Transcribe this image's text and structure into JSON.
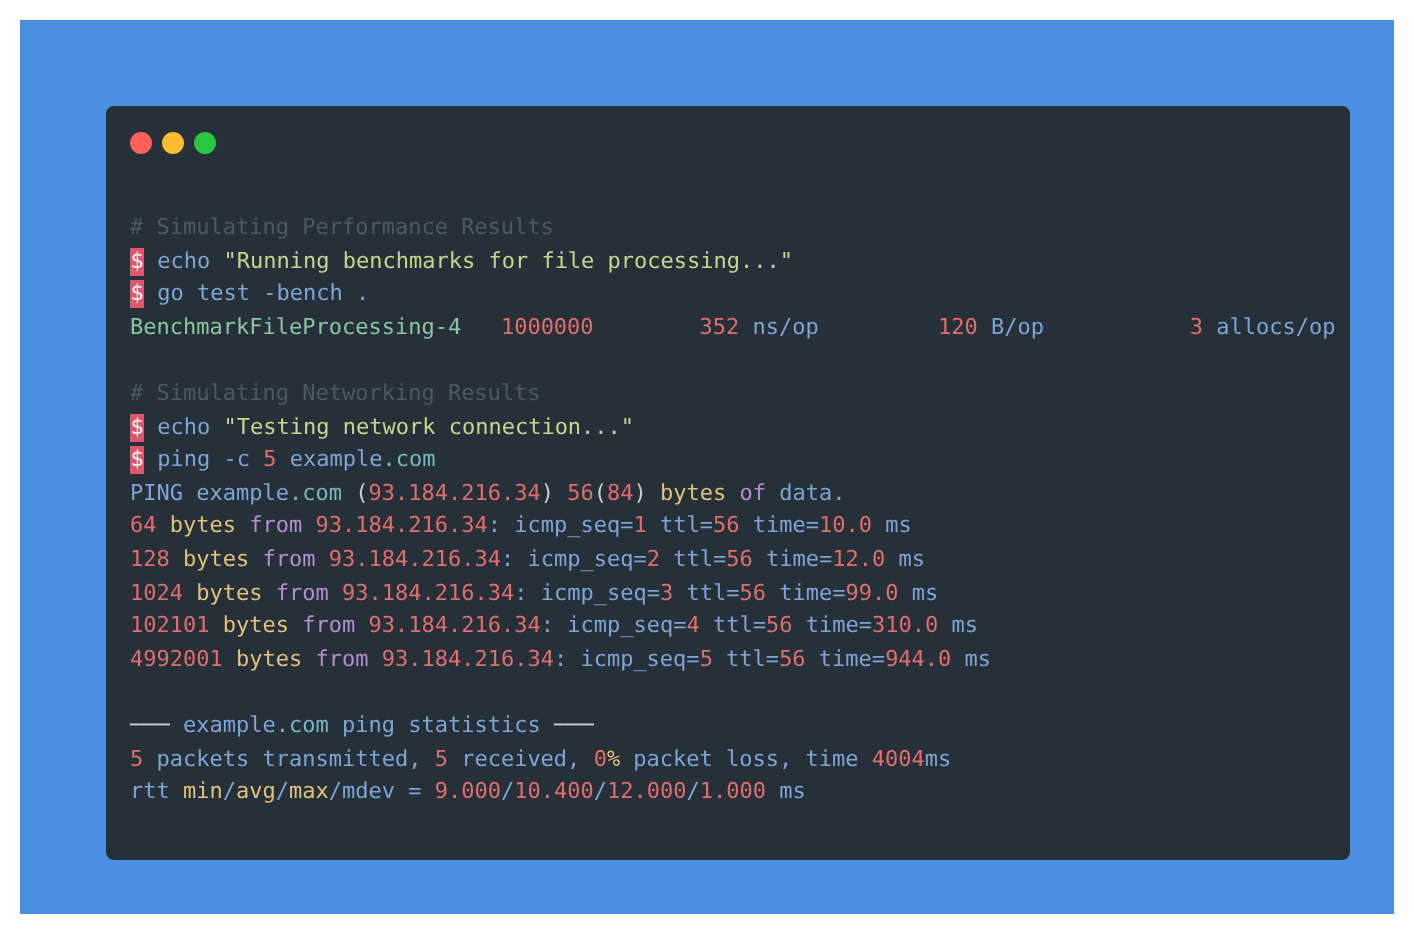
{
  "window": {
    "controls": [
      {
        "kind": "close"
      },
      {
        "kind": "minimize"
      },
      {
        "kind": "maximize"
      }
    ]
  },
  "blocks": [
    {
      "lines": [
        [
          {
            "kind": "comment",
            "text": "# Simulating Performance Results"
          }
        ],
        [
          {
            "kind": "prompt",
            "text": "$"
          },
          {
            "kind": "command",
            "text": " echo "
          },
          {
            "kind": "string",
            "text": "\"Running benchmarks for file processing...\""
          }
        ],
        [
          {
            "kind": "prompt",
            "text": "$"
          },
          {
            "kind": "command",
            "text": " go test -bench ."
          }
        ],
        [
          {
            "kind": "name",
            "text": "BenchmarkFileProcessing-4"
          },
          {
            "kind": "number",
            "text": "   1000000"
          },
          {
            "kind": "number",
            "text": "        352"
          },
          {
            "kind": "command",
            "text": " ns/op"
          },
          {
            "kind": "number",
            "text": "         120"
          },
          {
            "kind": "command",
            "text": " B/op"
          },
          {
            "kind": "number",
            "text": "           3"
          },
          {
            "kind": "command",
            "text": " allocs/op"
          }
        ]
      ]
    },
    {
      "lines": [
        [
          {
            "kind": "comment",
            "text": "# Simulating Networking Results"
          }
        ],
        [
          {
            "kind": "prompt",
            "text": "$"
          },
          {
            "kind": "command",
            "text": " echo "
          },
          {
            "kind": "string",
            "text": "\"Testing network connection...\""
          }
        ],
        [
          {
            "kind": "prompt",
            "text": "$"
          },
          {
            "kind": "command",
            "text": " ping -c "
          },
          {
            "kind": "number",
            "text": "5"
          },
          {
            "kind": "command",
            "text": " example"
          },
          {
            "kind": "domain",
            "text": ".com"
          }
        ],
        [
          {
            "kind": "command",
            "text": "PING example"
          },
          {
            "kind": "domain",
            "text": ".com"
          },
          {
            "kind": "plain",
            "text": " ("
          },
          {
            "kind": "number",
            "text": "93.184.216.34"
          },
          {
            "kind": "plain",
            "text": ") "
          },
          {
            "kind": "number",
            "text": "56"
          },
          {
            "kind": "plain",
            "text": "("
          },
          {
            "kind": "number",
            "text": "84"
          },
          {
            "kind": "plain",
            "text": ") "
          },
          {
            "kind": "unit",
            "text": "bytes"
          },
          {
            "kind": "keyword",
            "text": " of "
          },
          {
            "kind": "command",
            "text": "data."
          }
        ],
        [
          {
            "kind": "number",
            "text": "64"
          },
          {
            "kind": "unit",
            "text": " bytes"
          },
          {
            "kind": "keyword",
            "text": " from "
          },
          {
            "kind": "number",
            "text": "93.184.216.34"
          },
          {
            "kind": "command",
            "text": ": icmp_seq="
          },
          {
            "kind": "number",
            "text": "1"
          },
          {
            "kind": "command",
            "text": " ttl="
          },
          {
            "kind": "number",
            "text": "56"
          },
          {
            "kind": "command",
            "text": " time="
          },
          {
            "kind": "number",
            "text": "10.0"
          },
          {
            "kind": "command",
            "text": " ms"
          }
        ],
        [
          {
            "kind": "number",
            "text": "128"
          },
          {
            "kind": "unit",
            "text": " bytes"
          },
          {
            "kind": "keyword",
            "text": " from "
          },
          {
            "kind": "number",
            "text": "93.184.216.34"
          },
          {
            "kind": "command",
            "text": ": icmp_seq="
          },
          {
            "kind": "number",
            "text": "2"
          },
          {
            "kind": "command",
            "text": " ttl="
          },
          {
            "kind": "number",
            "text": "56"
          },
          {
            "kind": "command",
            "text": " time="
          },
          {
            "kind": "number",
            "text": "12.0"
          },
          {
            "kind": "command",
            "text": " ms"
          }
        ],
        [
          {
            "kind": "number",
            "text": "1024"
          },
          {
            "kind": "unit",
            "text": " bytes"
          },
          {
            "kind": "keyword",
            "text": " from "
          },
          {
            "kind": "number",
            "text": "93.184.216.34"
          },
          {
            "kind": "command",
            "text": ": icmp_seq="
          },
          {
            "kind": "number",
            "text": "3"
          },
          {
            "kind": "command",
            "text": " ttl="
          },
          {
            "kind": "number",
            "text": "56"
          },
          {
            "kind": "command",
            "text": " time="
          },
          {
            "kind": "number",
            "text": "99.0"
          },
          {
            "kind": "command",
            "text": " ms"
          }
        ],
        [
          {
            "kind": "number",
            "text": "102101"
          },
          {
            "kind": "unit",
            "text": " bytes"
          },
          {
            "kind": "keyword",
            "text": " from "
          },
          {
            "kind": "number",
            "text": "93.184.216.34"
          },
          {
            "kind": "command",
            "text": ": icmp_seq="
          },
          {
            "kind": "number",
            "text": "4"
          },
          {
            "kind": "command",
            "text": " ttl="
          },
          {
            "kind": "number",
            "text": "56"
          },
          {
            "kind": "command",
            "text": " time="
          },
          {
            "kind": "number",
            "text": "310.0"
          },
          {
            "kind": "command",
            "text": " ms"
          }
        ],
        [
          {
            "kind": "number",
            "text": "4992001"
          },
          {
            "kind": "unit",
            "text": " bytes"
          },
          {
            "kind": "keyword",
            "text": " from "
          },
          {
            "kind": "number",
            "text": "93.184.216.34"
          },
          {
            "kind": "command",
            "text": ": icmp_seq="
          },
          {
            "kind": "number",
            "text": "5"
          },
          {
            "kind": "command",
            "text": " ttl="
          },
          {
            "kind": "number",
            "text": "56"
          },
          {
            "kind": "command",
            "text": " time="
          },
          {
            "kind": "number",
            "text": "944.0"
          },
          {
            "kind": "command",
            "text": " ms"
          }
        ]
      ]
    },
    {
      "lines": [
        [
          {
            "kind": "plain",
            "text": "─── "
          },
          {
            "kind": "command",
            "text": "example"
          },
          {
            "kind": "domain",
            "text": ".com"
          },
          {
            "kind": "command",
            "text": " ping statistics "
          },
          {
            "kind": "plain",
            "text": "───"
          }
        ],
        [
          {
            "kind": "number",
            "text": "5"
          },
          {
            "kind": "command",
            "text": " packets transmitted, "
          },
          {
            "kind": "number",
            "text": "5"
          },
          {
            "kind": "command",
            "text": " received, "
          },
          {
            "kind": "number",
            "text": "0"
          },
          {
            "kind": "unit",
            "text": "%"
          },
          {
            "kind": "command",
            "text": " packet loss, time "
          },
          {
            "kind": "number",
            "text": "4004"
          },
          {
            "kind": "command",
            "text": "ms"
          }
        ],
        [
          {
            "kind": "command",
            "text": "rtt "
          },
          {
            "kind": "unit",
            "text": "min"
          },
          {
            "kind": "command",
            "text": "/"
          },
          {
            "kind": "unit",
            "text": "avg"
          },
          {
            "kind": "command",
            "text": "/"
          },
          {
            "kind": "unit",
            "text": "max"
          },
          {
            "kind": "command",
            "text": "/mdev = "
          },
          {
            "kind": "number",
            "text": "9.000"
          },
          {
            "kind": "command",
            "text": "/"
          },
          {
            "kind": "number",
            "text": "10.400"
          },
          {
            "kind": "command",
            "text": "/"
          },
          {
            "kind": "number",
            "text": "12.000"
          },
          {
            "kind": "command",
            "text": "/"
          },
          {
            "kind": "number",
            "text": "1.000"
          },
          {
            "kind": "command",
            "text": " ms"
          }
        ]
      ]
    }
  ]
}
